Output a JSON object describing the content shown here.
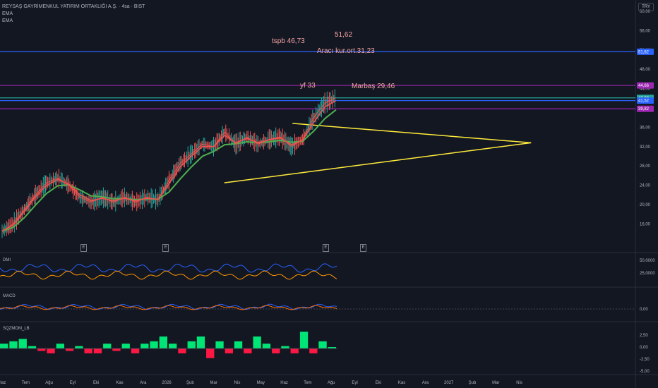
{
  "header": {
    "symbol_title": "REYSAŞ GAYRİMENKUL YATIRIM ORTAKLIĞI A.Ş. · 4sa · BIST",
    "indicator_1": "EMA",
    "indicator_2": "EMA"
  },
  "currency_button": "TRY",
  "annotations": [
    {
      "text": "tspb 46,73"
    },
    {
      "text": "51,62"
    },
    {
      "text": "Aracı kur.ort.31,23"
    },
    {
      "text": "yf 33"
    },
    {
      "text": "Marbaş 29,46"
    }
  ],
  "panes": {
    "dmi": {
      "title": "DMI",
      "labels": [
        "50,0000",
        "25,0000"
      ]
    },
    "macd": {
      "title": "MACD",
      "labels": [
        "0,00"
      ]
    },
    "sqzmom": {
      "title": "SQZMOM_LB",
      "labels": [
        "2,50",
        "0,00",
        "-2,50",
        "-5,00"
      ]
    }
  },
  "event_marker": "E",
  "chart_data": {
    "type": "line",
    "x_ticks": [
      "Haz",
      "Tem",
      "Ağu",
      "Eyl",
      "Eki",
      "Kas",
      "Ara",
      "2026",
      "Şub",
      "Mar",
      "Nis",
      "May",
      "Haz",
      "Tem",
      "Ağu",
      "Eyl",
      "Eki",
      "Kas",
      "Ara",
      "2027",
      "Şub",
      "Mar",
      "Nis"
    ],
    "y_ticks": [
      "60,00",
      "56,00",
      "52,00",
      "48,00",
      "44,00",
      "40,00",
      "36,00",
      "32,00",
      "28,00",
      "24,00",
      "20,00",
      "16,00"
    ],
    "ylim": [
      14,
      62
    ],
    "price": [
      14.5,
      16,
      19,
      22,
      24.5,
      25.5,
      24,
      21.5,
      20.5,
      21.5,
      20.5,
      21.5,
      20.5,
      21.5,
      21,
      25,
      28.5,
      30.5,
      32.5,
      32,
      35,
      32.5,
      34,
      32.5,
      33.5,
      34,
      32,
      33.5,
      38,
      41,
      42.1
    ],
    "ema_fast": [
      14.5,
      15.8,
      18.6,
      21.6,
      24,
      25.2,
      24.2,
      22,
      20.8,
      21.3,
      20.8,
      21.3,
      20.8,
      21.3,
      21.1,
      24.3,
      27.8,
      30,
      32,
      32,
      34.3,
      32.8,
      33.7,
      32.8,
      33.4,
      33.8,
      32.4,
      33.3,
      37,
      40.2,
      41.5
    ],
    "ema_slow": [
      14.5,
      15.3,
      17.3,
      19.9,
      22.3,
      23.9,
      24.1,
      23,
      21.8,
      21.6,
      21.2,
      21.3,
      21,
      21.2,
      21.1,
      22.6,
      25.3,
      27.8,
      30,
      31,
      32.4,
      32.6,
      33,
      32.8,
      33,
      33.3,
      32.9,
      33.1,
      35.2,
      37.8,
      39.6
    ],
    "triangle": {
      "upper": [
        [
          12.35,
          36.8
        ],
        [
          22.5,
          32.8
        ]
      ],
      "lower": [
        [
          9.45,
          24.5
        ],
        [
          22.5,
          32.8
        ]
      ]
    },
    "horizontal_levels": [
      {
        "label": "51,62",
        "value": 51.62,
        "color": "#2962ff"
      },
      {
        "label": "44,66",
        "value": 44.66,
        "color": "#9c27b0"
      },
      {
        "label": "42,08",
        "value": 42.08,
        "color": "#26a69a"
      },
      {
        "label": "41,52",
        "value": 41.52,
        "color": "#2962ff"
      },
      {
        "label": "39,82",
        "value": 39.82,
        "color": "#9c27b0"
      }
    ],
    "events_at": [
      3.45,
      6.95,
      13.75,
      15.35
    ],
    "sqzmom_hist": [
      1,
      1.5,
      2,
      0.5,
      -0.5,
      -1,
      1,
      -0.5,
      0.5,
      -1,
      -1,
      1,
      -0.5,
      1,
      -1,
      1,
      1.5,
      2.5,
      1,
      -1,
      1.5,
      2.5,
      -2,
      1.5,
      -1,
      1.5,
      -1,
      2.5,
      1,
      -1,
      0.5,
      -1,
      3.5,
      -1,
      1.5,
      0.3
    ],
    "colors": {
      "price": "#ef5350",
      "ema_fast": "#ef5350",
      "ema_slow": "#4caf50",
      "triangle": "#ffeb3b",
      "dmi_plus": "#2962ff",
      "dmi_minus": "#ff9800",
      "macd": "#2962ff",
      "signal": "#ff6d00"
    }
  }
}
